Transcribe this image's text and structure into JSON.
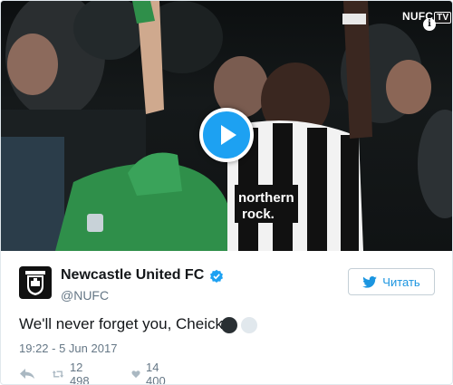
{
  "video": {
    "channel_logo": "NUFC",
    "channel_badge": "TV",
    "shirt_sponsor": "northern rock",
    "icons": {
      "play": "play-icon",
      "info": "info-icon"
    }
  },
  "tweet": {
    "author_name": "Newcastle United FC",
    "author_handle": "@NUFC",
    "verified": true,
    "follow_label": "Читать",
    "text": "We'll never forget you, Cheick.",
    "text_emojis": [
      "black-circle",
      "white-circle"
    ],
    "timestamp": "19:22 - 5 Jun 2017",
    "retweet_count": "12 498",
    "like_count": "14 400"
  },
  "colors": {
    "accent": "#1da1f2",
    "link": "#1b95e0",
    "muted": "#657786",
    "text": "#14171a"
  }
}
